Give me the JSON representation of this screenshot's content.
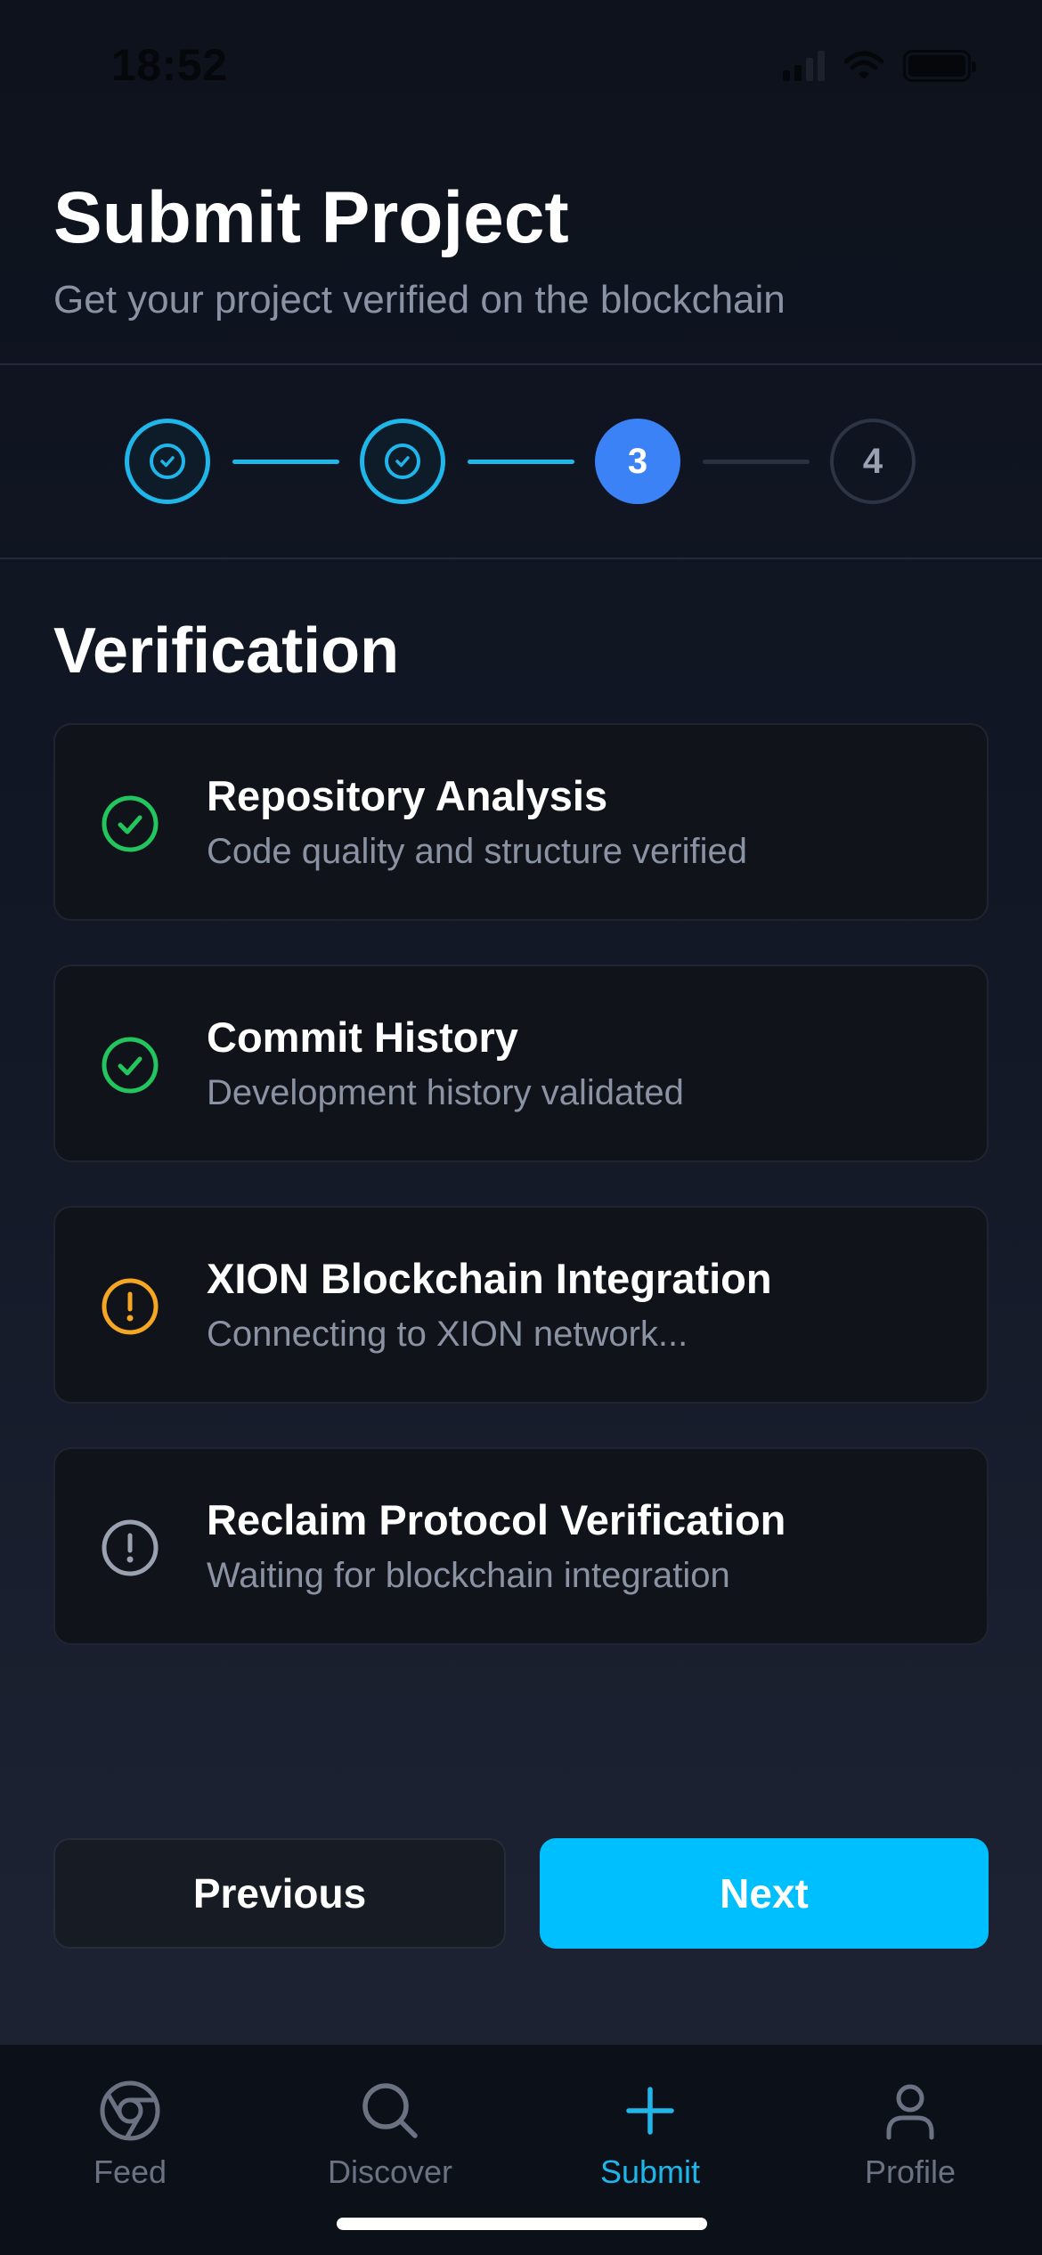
{
  "status_bar": {
    "time": "18:52"
  },
  "header": {
    "title": "Submit Project",
    "subtitle": "Get your project verified on the blockchain"
  },
  "stepper": {
    "current_step": 3,
    "total_steps": 4,
    "steps": [
      {
        "state": "done"
      },
      {
        "state": "done"
      },
      {
        "label": "3",
        "state": "active"
      },
      {
        "label": "4",
        "state": "pending"
      }
    ]
  },
  "section": {
    "title": "Verification"
  },
  "checks": [
    {
      "title": "Repository Analysis",
      "description": "Code quality and structure verified",
      "status": "success",
      "icon": "check-circle-icon"
    },
    {
      "title": "Commit History",
      "description": "Development history validated",
      "status": "success",
      "icon": "check-circle-icon"
    },
    {
      "title": "XION Blockchain Integration",
      "description": "Connecting to XION network...",
      "status": "in-progress",
      "icon": "alert-circle-icon"
    },
    {
      "title": "Reclaim Protocol Verification",
      "description": "Waiting for blockchain integration",
      "status": "pending",
      "icon": "alert-circle-icon"
    }
  ],
  "actions": {
    "previous_label": "Previous",
    "next_label": "Next"
  },
  "tabs": [
    {
      "label": "Feed",
      "icon": "chrome-icon",
      "active": false
    },
    {
      "label": "Discover",
      "icon": "search-icon",
      "active": false
    },
    {
      "label": "Submit",
      "icon": "plus-icon",
      "active": true
    },
    {
      "label": "Profile",
      "icon": "user-icon",
      "active": false
    }
  ],
  "colors": {
    "accent": "#00bfff",
    "active_step": "#3b82f6",
    "success": "#22c55e",
    "warning": "#f5a623",
    "pending": "#9aa2b1"
  }
}
